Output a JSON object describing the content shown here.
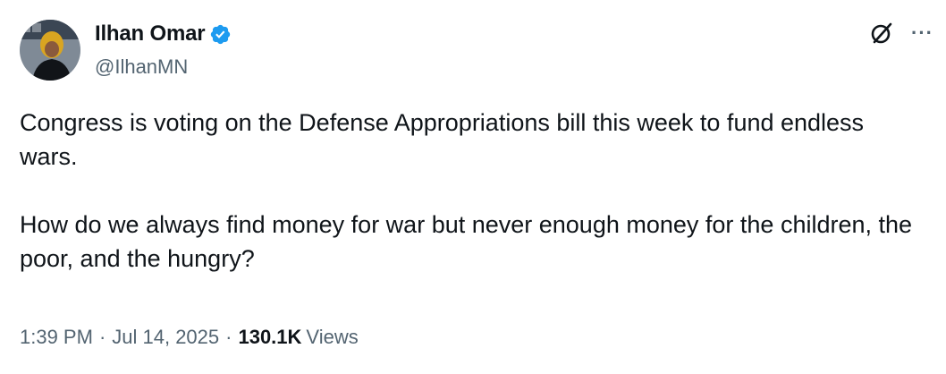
{
  "author": {
    "display_name": "Ilhan Omar",
    "handle": "@IlhanMN",
    "verified": true
  },
  "icons": {
    "avatar": "avatar",
    "verified": "verified-badge-icon",
    "grok": "grok-icon",
    "more": "more-options-icon"
  },
  "tweet": {
    "paragraphs": [
      "Congress is voting on the Defense Appropriations bill this week to fund endless wars.",
      "How do we always find money for war but never enough money for the children, the poor, and the hungry?"
    ]
  },
  "meta": {
    "time": "1:39 PM",
    "separator": "·",
    "date": "Jul 14, 2025",
    "views_count": "130.1K",
    "views_label": "Views"
  },
  "colors": {
    "text_primary": "#0f1419",
    "text_secondary": "#536471",
    "verified_blue": "#1d9bf0"
  }
}
